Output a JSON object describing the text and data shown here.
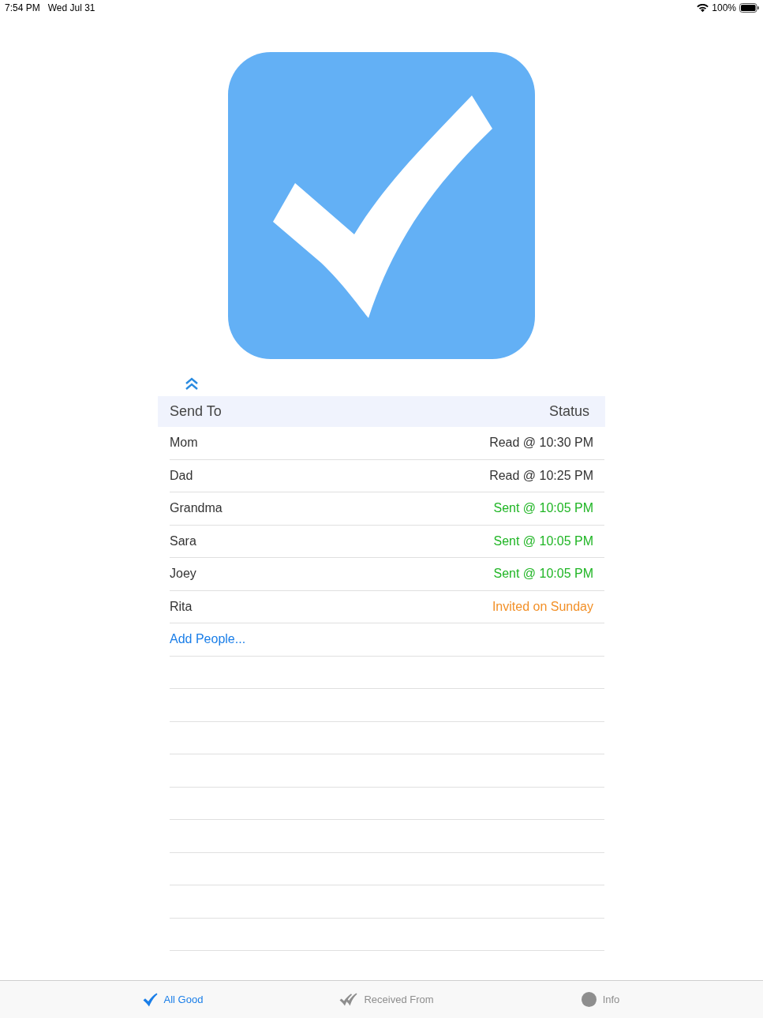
{
  "status_bar": {
    "time": "7:54 PM",
    "date": "Wed Jul 31",
    "battery": "100%"
  },
  "table": {
    "columns": [
      "Send To",
      "Status"
    ],
    "rows": [
      {
        "name": "Mom",
        "status": "Read @ 10:30 PM",
        "color": "#333333"
      },
      {
        "name": "Dad",
        "status": "Read @ 10:25 PM",
        "color": "#333333"
      },
      {
        "name": "Grandma",
        "status": "Sent @ 10:05 PM",
        "color": "#1fb524"
      },
      {
        "name": "Sara",
        "status": "Sent @ 10:05 PM",
        "color": "#1fb524"
      },
      {
        "name": "Joey",
        "status": "Sent @ 10:05 PM",
        "color": "#1fb524"
      },
      {
        "name": "Rita",
        "status": "Invited on Sunday",
        "color": "#f29028"
      }
    ],
    "add_link": "Add People..."
  },
  "tab_bar": {
    "tabs": [
      {
        "label": "All Good",
        "kind": "check",
        "selected": true
      },
      {
        "label": "Received From",
        "kind": "double-check",
        "selected": false
      },
      {
        "label": "Info",
        "kind": "circle",
        "selected": false
      }
    ]
  }
}
